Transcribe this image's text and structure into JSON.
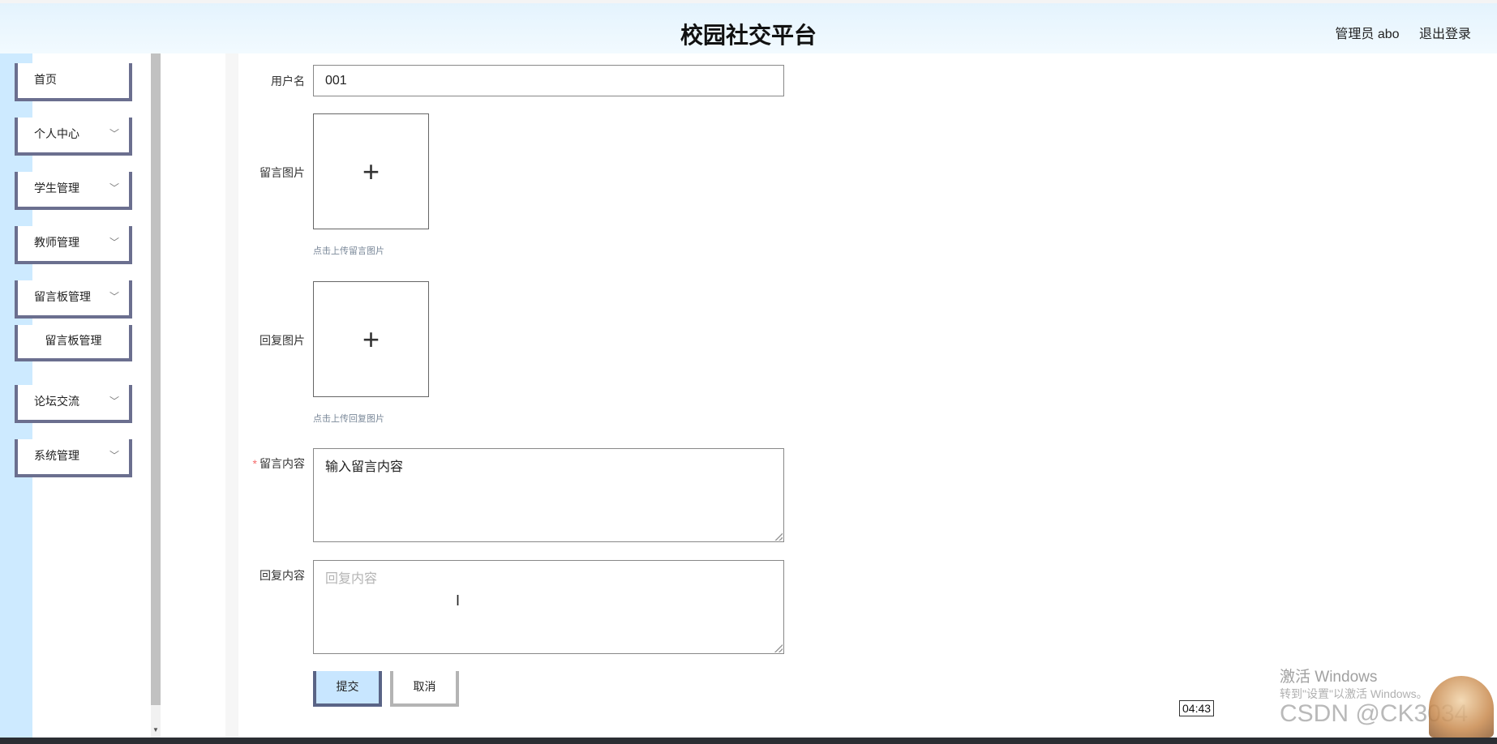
{
  "header": {
    "title": "校园社交平台",
    "user_label": "管理员 abo",
    "logout_label": "退出登录"
  },
  "sidebar": {
    "items": [
      {
        "label": "首页",
        "has_chevron": false
      },
      {
        "label": "个人中心",
        "has_chevron": true
      },
      {
        "label": "学生管理",
        "has_chevron": true
      },
      {
        "label": "教师管理",
        "has_chevron": true
      },
      {
        "label": "留言板管理",
        "has_chevron": true
      },
      {
        "label": "留言板管理",
        "has_chevron": false,
        "submenu": true
      },
      {
        "label": "论坛交流",
        "has_chevron": true
      },
      {
        "label": "系统管理",
        "has_chevron": true
      }
    ]
  },
  "form": {
    "username_label": "用户名",
    "username_value": "001",
    "message_image_label": "留言图片",
    "message_image_hint": "点击上传留言图片",
    "reply_image_label": "回复图片",
    "reply_image_hint": "点击上传回复图片",
    "message_content_label": "留言内容",
    "message_content_value": "输入留言内容",
    "reply_content_label": "回复内容",
    "reply_content_placeholder": "回复内容",
    "submit_label": "提交",
    "cancel_label": "取消",
    "plus_glyph": "+"
  },
  "overlay": {
    "windows_activate": "激活 Windows",
    "windows_activate_sub": "转到\"设置\"以激活 Windows。",
    "time": "04:43",
    "csdn": "CSDN @CK3034"
  },
  "colors": {
    "header_bg": "#e4f3fd",
    "sidebar_bg": "#cdeaff",
    "menu_border": "#6b6f8f",
    "submit_bg": "#c8e6ff"
  }
}
